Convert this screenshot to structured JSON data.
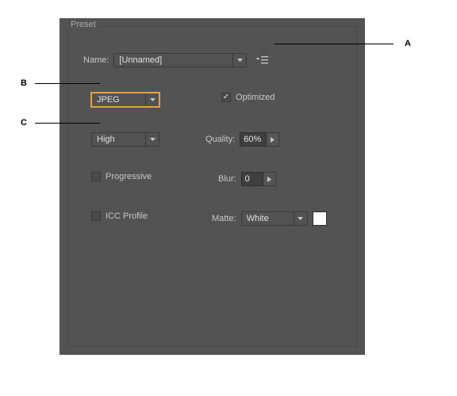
{
  "fieldset_title": "Preset",
  "name_label": "Name:",
  "name_value": "[Unnamed]",
  "format_value": "JPEG",
  "optimized_label": "Optimized",
  "optimized_checked": true,
  "quality_level_value": "High",
  "quality_label": "Quality:",
  "quality_value": "60%",
  "progressive_label": "Progressive",
  "progressive_checked": false,
  "blur_label": "Blur:",
  "blur_value": "0",
  "icc_label": "ICC Profile",
  "icc_checked": false,
  "matte_label": "Matte:",
  "matte_value": "White",
  "matte_swatch": "#ffffff",
  "callouts": {
    "a": "A",
    "b": "B",
    "c": "C"
  }
}
